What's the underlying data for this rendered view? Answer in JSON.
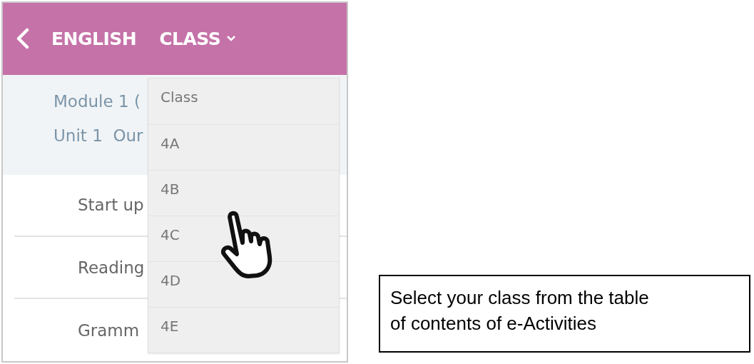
{
  "header": {
    "title": "ENGLISH",
    "class_menu": {
      "label": "CLASS",
      "expanded": true,
      "options": [
        "Class",
        "4A",
        "4B",
        "4C",
        "4D",
        "4E"
      ]
    }
  },
  "course": {
    "module": "Module 1 (",
    "unit": "Unit 1  Our"
  },
  "lessons": [
    "Start up",
    "Reading",
    "Gramm"
  ],
  "callout": {
    "lines": [
      "Select your class from the table",
      "of contents of e-Activities"
    ]
  }
}
